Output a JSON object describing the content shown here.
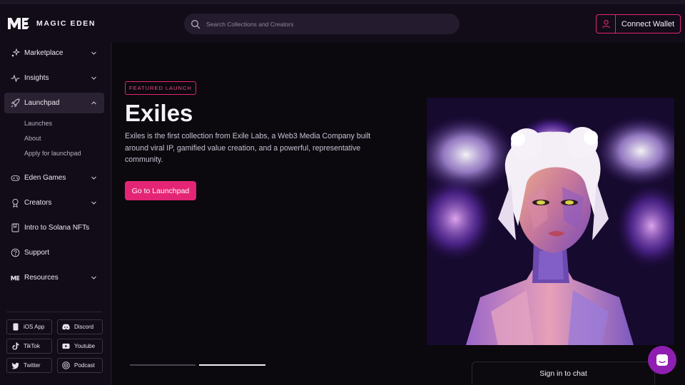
{
  "header": {
    "brand": "MAGIC EDEN",
    "search_placeholder": "Search Collections and Creators",
    "connect_wallet": "Connect Wallet"
  },
  "sidebar": {
    "items": [
      {
        "label": "Marketplace",
        "icon": "sparkle-icon"
      },
      {
        "label": "Insights",
        "icon": "pulse-icon"
      },
      {
        "label": "Launchpad",
        "icon": "rocket-icon"
      },
      {
        "label": "Eden Games",
        "icon": "gamepad-icon"
      },
      {
        "label": "Creators",
        "icon": "award-icon"
      },
      {
        "label": "Intro to Solana NFTs",
        "icon": "book-icon"
      },
      {
        "label": "Support",
        "icon": "help-icon"
      },
      {
        "label": "Resources",
        "icon": "me-logo-icon"
      }
    ],
    "launchpad_sub": [
      "Launches",
      "About",
      "Apply for launchpad"
    ],
    "socials": [
      "iOS App",
      "Discord",
      "TikTok",
      "Youtube",
      "Twitter",
      "Podcast"
    ]
  },
  "hero": {
    "badge": "FEATURED LAUNCH",
    "title": "Exiles",
    "description": "Exiles is the first collection from Exile Labs, a Web3 Media Company built around viral IP, gamified value creation, and a powerful, representative community.",
    "cta": "Go to Launchpad",
    "slide_index": 2,
    "slide_count": 2
  },
  "chat": {
    "label": "Sign in to chat"
  },
  "colors": {
    "accent": "#e42575",
    "background": "#120c18",
    "chat_fab": "#8e1fb0"
  }
}
